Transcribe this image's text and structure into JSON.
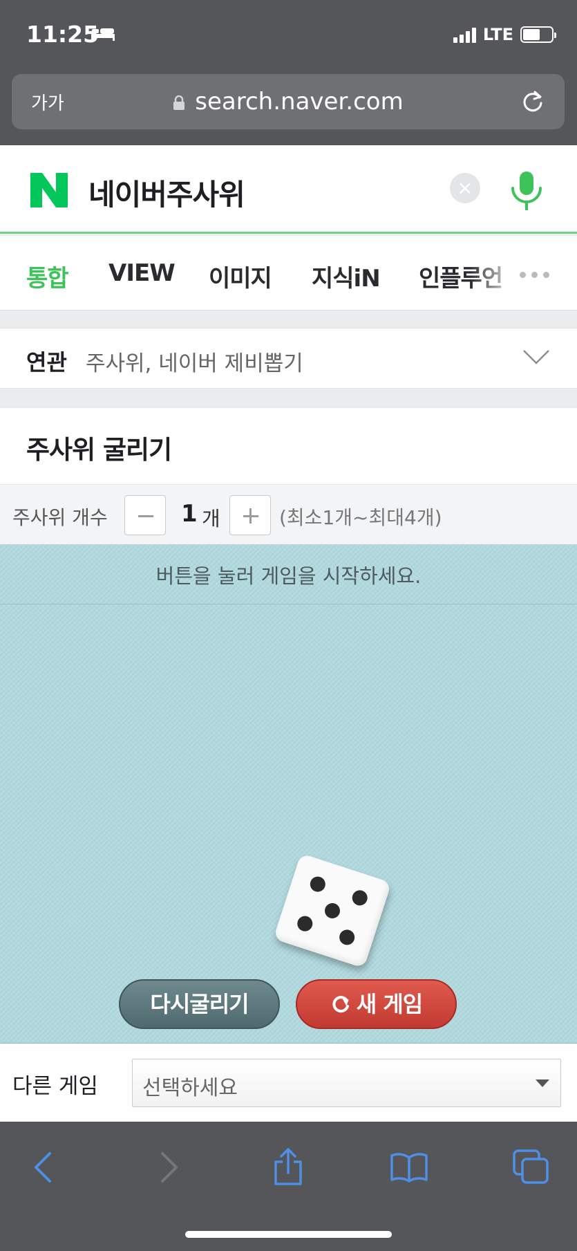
{
  "status_bar": {
    "time": "11:25",
    "network": "LTE",
    "battery_level": 0.6
  },
  "browser": {
    "text_size_label": "가가",
    "url": "search.naver.com"
  },
  "search": {
    "query": "네이버주사위",
    "brand_color": "#03c75a"
  },
  "tabs": [
    {
      "label": "통합",
      "active": true
    },
    {
      "label": "VIEW",
      "active": false
    },
    {
      "label": "이미지",
      "active": false
    },
    {
      "label": "지식iN",
      "active": false
    },
    {
      "label": "인플루언",
      "active": false
    }
  ],
  "related": {
    "label": "연관",
    "text": "주사위, 네이버 제비뽑기"
  },
  "dice_game": {
    "title": "주사위 굴리기",
    "count_label": "주사위 개수",
    "count_value": "1",
    "count_unit": "개",
    "count_range": "(최소1개~최대4개)",
    "message": "버튼을 눌러 게임을 시작하세요.",
    "die_face": 5,
    "reroll_label": "다시굴리기",
    "new_game_label": "새 게임",
    "board_color": "#b1dadf"
  },
  "other_game": {
    "label": "다른 게임",
    "select_value": "선택하세요"
  },
  "toolbar": {
    "icons": [
      "back-icon",
      "forward-icon",
      "share-icon",
      "bookmarks-icon",
      "tabs-icon"
    ]
  }
}
